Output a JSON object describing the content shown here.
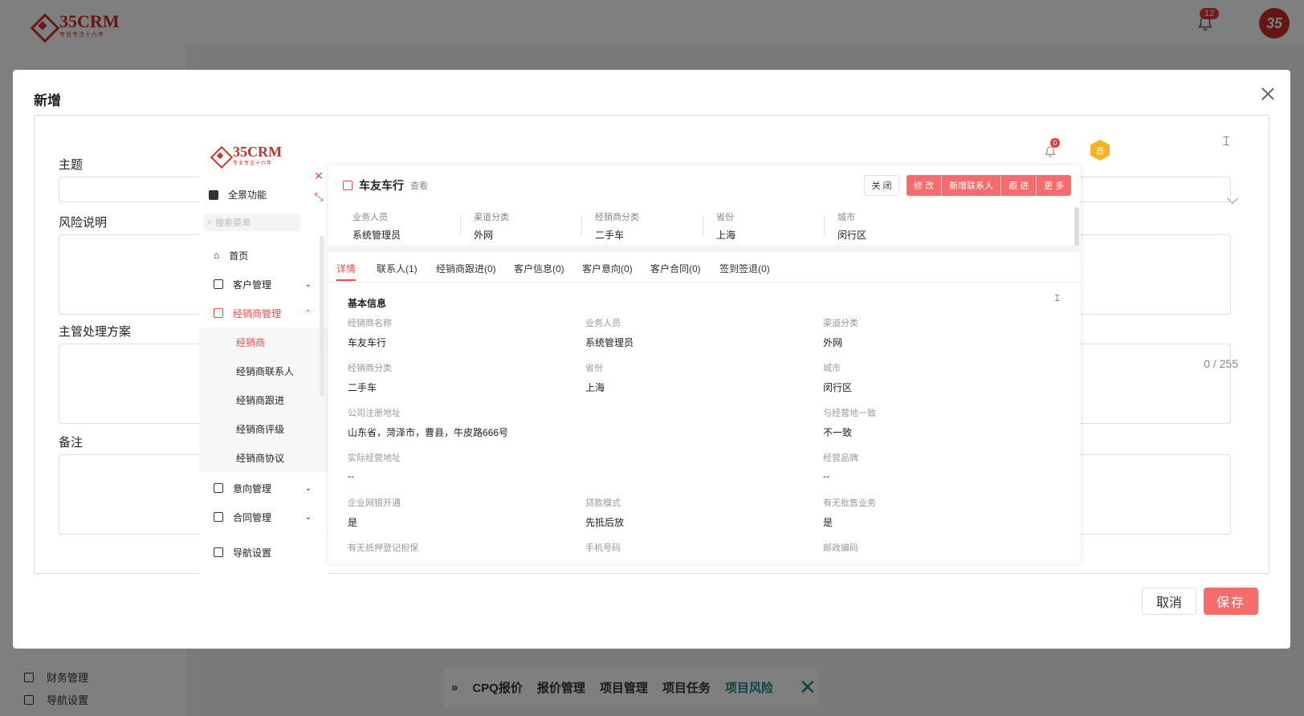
{
  "app": {
    "logo_text": "35CRM",
    "logo_sub": "专业专注十六年",
    "notification_count": "12",
    "avatar_text": "35",
    "sidebar_items": [
      {
        "label": "财务管理"
      },
      {
        "label": "导航设置"
      }
    ],
    "bottom_nav": {
      "items": [
        "CPQ报价",
        "报价管理",
        "项目管理",
        "项目任务",
        "项目风险"
      ],
      "active": "项目风险"
    }
  },
  "modal": {
    "title": "新增",
    "fields": {
      "subject_label": "主题",
      "risk_label": "风险说明",
      "plan_label": "主管处理方案",
      "remark_label": "备注",
      "char_count": "0 / 255"
    },
    "cancel_label": "取消",
    "save_label": "保存"
  },
  "embed": {
    "logo_text": "35CRM",
    "logo_sub": "专业专注十六年",
    "notification_count": "0",
    "avatar_text": "员",
    "sidebar": {
      "all_functions": "全景功能",
      "search_placeholder": "搜索菜单",
      "items": [
        {
          "label": "首页"
        },
        {
          "label": "客户管理"
        },
        {
          "label": "经销商管理"
        },
        {
          "label": "意向管理"
        },
        {
          "label": "合同管理"
        },
        {
          "label": "导航设置"
        }
      ],
      "subitems": [
        {
          "label": "经销商",
          "active": true
        },
        {
          "label": "经销商联系人"
        },
        {
          "label": "经销商跟进"
        },
        {
          "label": "经销商评级"
        },
        {
          "label": "经销商协议"
        }
      ]
    },
    "detail": {
      "title": "车友车行",
      "view_label": "查看",
      "close_label": "关 闭",
      "actions": [
        "修 改",
        "新增联系人",
        "跟 进",
        "更 多"
      ],
      "summary": [
        {
          "key": "业务人员",
          "value": "系统管理员"
        },
        {
          "key": "渠道分类",
          "value": "外网"
        },
        {
          "key": "经销商分类",
          "value": "二手车"
        },
        {
          "key": "省份",
          "value": "上海"
        },
        {
          "key": "城市",
          "value": "闵行区"
        }
      ],
      "tabs": [
        "详情",
        "联系人(1)",
        "经销商跟进(0)",
        "客户信息(0)",
        "客户意向(0)",
        "客户合同(0)",
        "签到签退(0)"
      ],
      "section_title": "基本信息",
      "fields": [
        {
          "key": "经销商名称",
          "value": "车友车行"
        },
        {
          "key": "业务人员",
          "value": "系统管理员"
        },
        {
          "key": "渠道分类",
          "value": "外网"
        },
        {
          "key": "经销商分类",
          "value": "二手车"
        },
        {
          "key": "省份",
          "value": "上海"
        },
        {
          "key": "城市",
          "value": "闵行区"
        },
        {
          "key": "公司注册地址",
          "value": "山东省，菏泽市，曹县，牛皮路666号"
        },
        {
          "key": "与经营地一致",
          "value": "不一致"
        },
        {
          "key": "实际经营地址",
          "value": "--"
        },
        {
          "key": "经营品牌",
          "value": "--"
        },
        {
          "key": "企业网银开通",
          "value": "是"
        },
        {
          "key": "贷款模式",
          "value": "先抵后放"
        },
        {
          "key": "有无批售业务",
          "value": "是"
        },
        {
          "key": "有无抵押登记担保",
          "value": ""
        },
        {
          "key": "手机号码",
          "value": ""
        },
        {
          "key": "邮政编码",
          "value": ""
        }
      ]
    }
  },
  "colors": {
    "accent": "#f56c6c",
    "brand": "#c62f2a",
    "teal": "#1a8a8a"
  }
}
